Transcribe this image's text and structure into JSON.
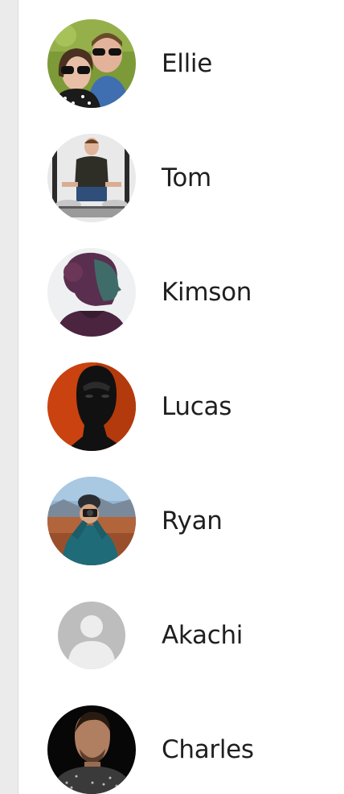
{
  "contacts": [
    {
      "name": "Ellie",
      "avatar_icon": "avatar-photo-icon"
    },
    {
      "name": "Tom",
      "avatar_icon": "avatar-photo-icon"
    },
    {
      "name": "Kimson",
      "avatar_icon": "avatar-photo-icon"
    },
    {
      "name": "Lucas",
      "avatar_icon": "avatar-photo-icon"
    },
    {
      "name": "Ryan",
      "avatar_icon": "avatar-photo-icon"
    },
    {
      "name": "Akachi",
      "avatar_icon": "default-user-icon"
    },
    {
      "name": "Charles",
      "avatar_icon": "avatar-photo-icon"
    }
  ],
  "colors": {
    "rail": "#ebebeb",
    "text": "#1f1f1f",
    "placeholder_avatar": "#bdbdbd"
  }
}
